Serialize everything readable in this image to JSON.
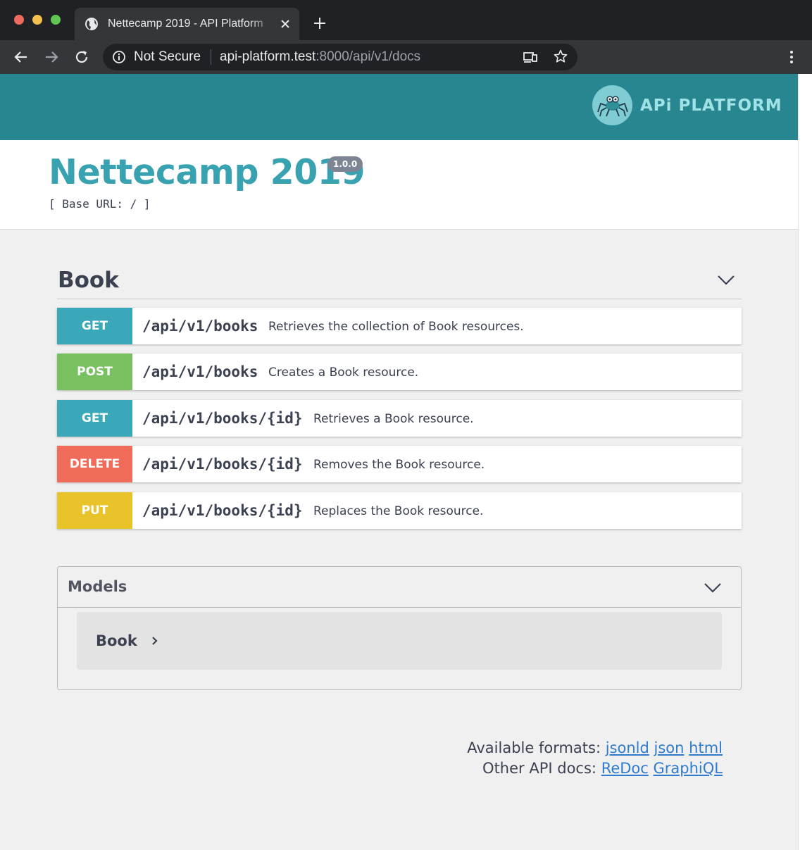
{
  "browser": {
    "tab_title": "Nettecamp 2019 - API Platform",
    "security_label": "Not Secure",
    "url_host": "api-platform.test",
    "url_rest": ":8000/api/v1/docs"
  },
  "header": {
    "logo_text": "APi PLATFORM",
    "background_color": "#288690"
  },
  "info": {
    "title": "Nettecamp 2019",
    "version": "1.0.0",
    "base_url": "[ Base URL: / ]"
  },
  "section": {
    "title": "Book",
    "operations": [
      {
        "method": "GET",
        "path": "/api/v1/books",
        "description": "Retrieves the collection of Book resources.",
        "color": "#3aa8b8"
      },
      {
        "method": "POST",
        "path": "/api/v1/books",
        "description": "Creates a Book resource.",
        "color": "#78c060"
      },
      {
        "method": "GET",
        "path": "/api/v1/books/{id}",
        "description": "Retrieves a Book resource.",
        "color": "#3aa8b8"
      },
      {
        "method": "DELETE",
        "path": "/api/v1/books/{id}",
        "description": "Removes the Book resource.",
        "color": "#f06b5a"
      },
      {
        "method": "PUT",
        "path": "/api/v1/books/{id}",
        "description": "Replaces the Book resource.",
        "color": "#e8c32a"
      }
    ]
  },
  "models": {
    "title": "Models",
    "items": [
      {
        "name": "Book"
      }
    ]
  },
  "footer": {
    "formats_label": "Available formats:",
    "formats": [
      "jsonld",
      "json",
      "html"
    ],
    "docs_label": "Other API docs:",
    "docs": [
      "ReDoc",
      "GraphiQL"
    ]
  }
}
